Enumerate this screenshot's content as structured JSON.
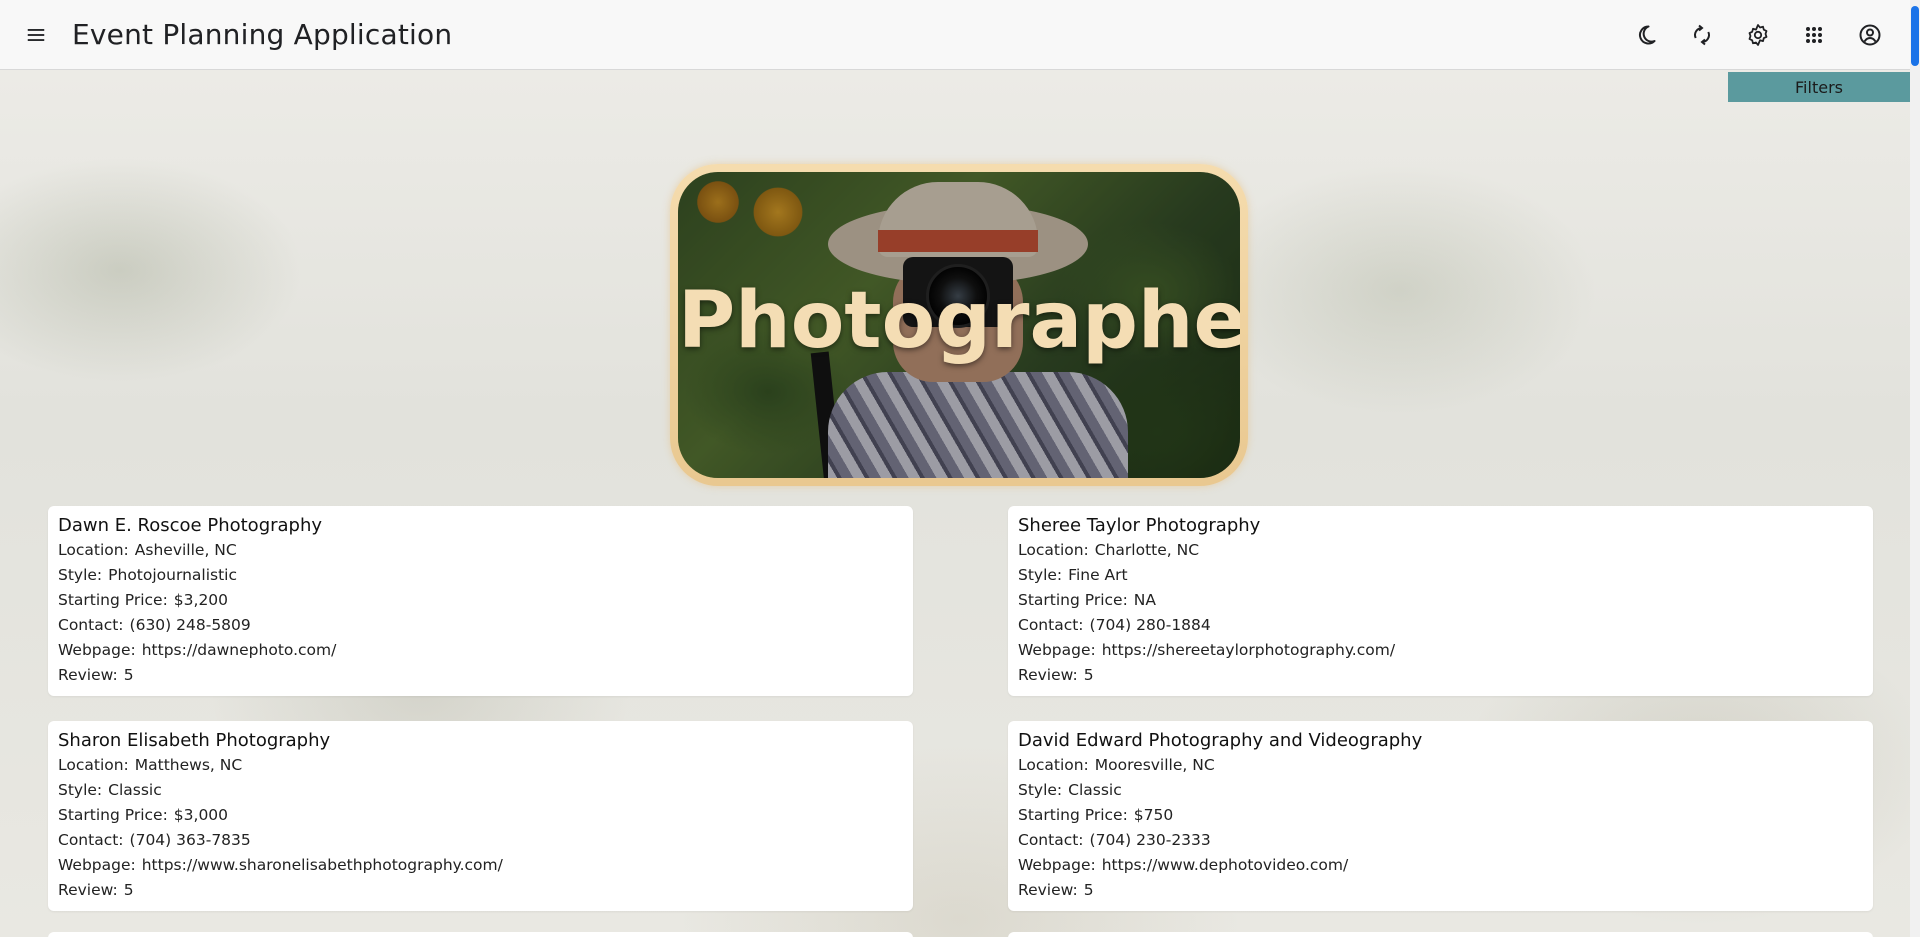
{
  "app": {
    "title": "Event Planning Application"
  },
  "toolbar": {
    "icons": [
      "menu-icon",
      "moon-icon",
      "sync-icon",
      "gear-icon",
      "apps-grid-icon",
      "account-circle-icon"
    ]
  },
  "filters": {
    "label": "Filters"
  },
  "hero": {
    "title": "Photographers"
  },
  "labels": {
    "location": "Location:",
    "style": "Style:",
    "price": "Starting Price:",
    "contact": "Contact:",
    "webpage": "Webpage:",
    "review": "Review:"
  },
  "vendors": [
    {
      "name": "Dawn E. Roscoe Photography",
      "location": "Asheville, NC",
      "style": "Photojournalistic",
      "price": "$3,200",
      "contact": "(630) 248-5809",
      "webpage": "https://dawnephoto.com/",
      "review": "5"
    },
    {
      "name": "Sheree Taylor Photography",
      "location": "Charlotte, NC",
      "style": "Fine Art",
      "price": "NA",
      "contact": "(704) 280-1884",
      "webpage": "https://shereetaylorphotography.com/",
      "review": "5"
    },
    {
      "name": "Sharon Elisabeth Photography",
      "location": "Matthews, NC",
      "style": "Classic",
      "price": "$3,000",
      "contact": "(704) 363-7835",
      "webpage": "https://www.sharonelisabethphotography.com/",
      "review": "5"
    },
    {
      "name": "David Edward Photography and Videography",
      "location": "Mooresville, NC",
      "style": "Classic",
      "price": "$750",
      "contact": "(704) 230-2333",
      "webpage": "https://www.dephotovideo.com/",
      "review": "5"
    }
  ],
  "colors": {
    "accent": "#5b9a9e",
    "scroll_thumb": "#1a73e8",
    "hero_border": "#f5dcae",
    "hero_text": "#f4ddb4"
  }
}
